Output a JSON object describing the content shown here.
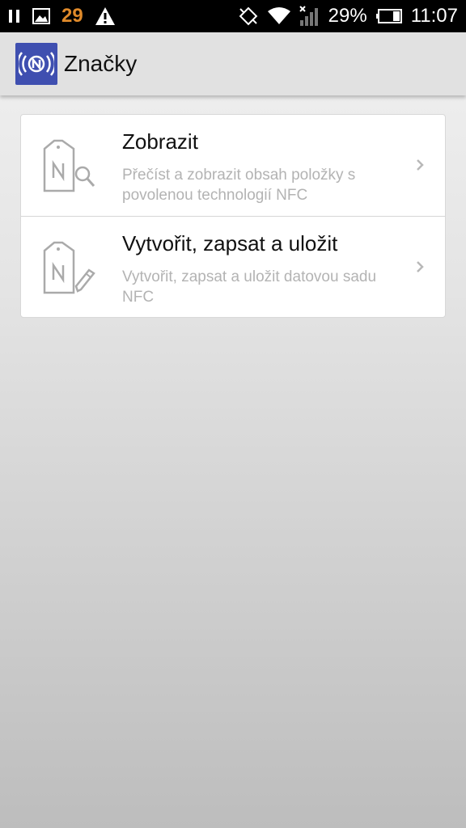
{
  "status_bar": {
    "notification_count": "29",
    "battery_percent": "29%",
    "time": "11:07",
    "icons": [
      "pause-icon",
      "image-icon",
      "warning-icon",
      "nfc-icon",
      "wifi-icon",
      "signal-icon",
      "battery-icon"
    ]
  },
  "action_bar": {
    "title": "Značky",
    "accent_color": "#3f4fb0"
  },
  "menu": {
    "items": [
      {
        "title": "Zobrazit",
        "description": "Přečíst a zobrazit obsah položky s povolenou technologií NFC",
        "icon": "nfc-tag-search-icon"
      },
      {
        "title": "Vytvořit, zapsat a uložit",
        "description": "Vytvořit, zapsat a uložit datovou sadu NFC",
        "icon": "nfc-tag-edit-icon"
      }
    ]
  }
}
